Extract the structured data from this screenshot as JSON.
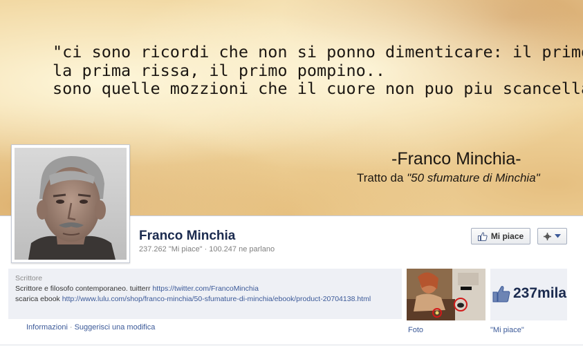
{
  "cover": {
    "quote": "\"ci sono ricordi che non si ponno dimenticare: il primo bacio,\nla prima rissa, il primo pompino..\nsono quelle mozzioni che il cuore non puo piu scancellare.\"",
    "signature": "-Franco Minchia-",
    "source_prefix": "Tratto da ",
    "source_title": "\"50 sfumature di Minchia\""
  },
  "page": {
    "name": "Franco Minchia",
    "likes": "237.262 \"Mi piace\"",
    "separator": "·",
    "talking": "100.247 ne parlano",
    "like_button": "Mi piace"
  },
  "about": {
    "category": "Scrittore",
    "description": "Scrittore e filosofo contemporaneo. tuitterr ",
    "twitter_link": "https://twitter.com/FrancoMinchia",
    "ebook_prefix": "scarica ebook ",
    "ebook_link": "http://www.lulu.com/shop/franco-minchia/50-sfumature-di-minchia/ebook/product-20704138.html"
  },
  "links": {
    "info": "Informazioni",
    "separator": "·",
    "suggest": "Suggerisci una modifica"
  },
  "apps": {
    "photos_label": "Foto",
    "likes_count": "237mila",
    "likes_label": "\"Mi piace\""
  },
  "icons": [
    "thumbs-up-icon",
    "gear-icon",
    "chevron-down-icon"
  ],
  "colors": {
    "name": "#1b2b4f",
    "link": "#3b5998",
    "box_bg": "#eef0f5"
  }
}
